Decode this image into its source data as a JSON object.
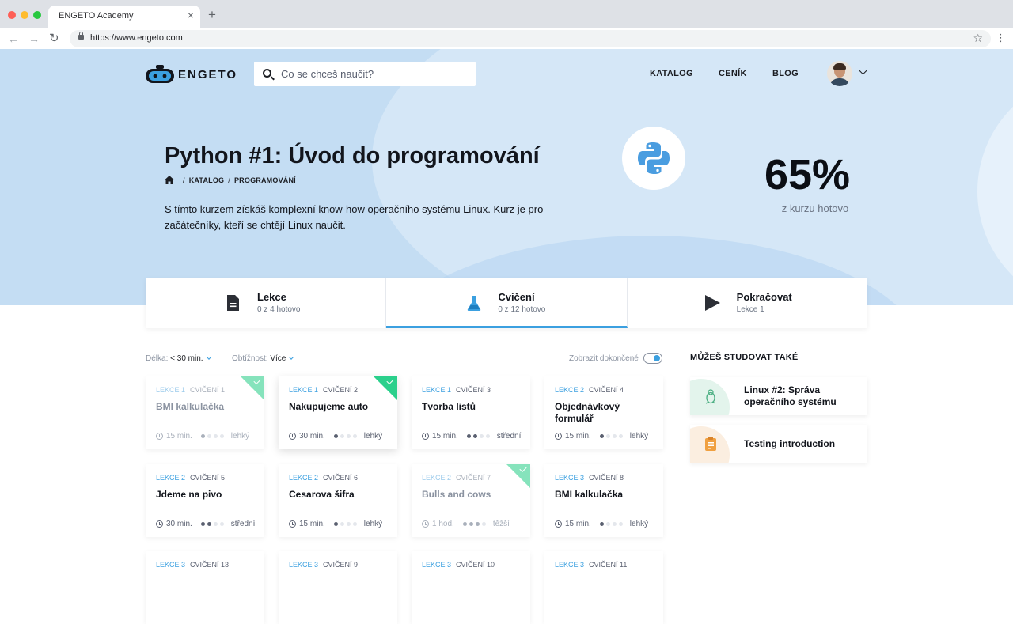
{
  "browser": {
    "tab_title": "ENGETO Academy",
    "tab_close": "×",
    "new_tab": "+",
    "url": "https://www.engeto.com",
    "back": "←",
    "forward": "→",
    "reload": "↻",
    "bookmark": "☆",
    "menu": "⋮"
  },
  "header": {
    "logo_text": "ENGETO",
    "search_placeholder": "Co se chceš naučit?",
    "nav": [
      "KATALOG",
      "CENÍK",
      "BLOG"
    ]
  },
  "hero": {
    "title": "Python #1: Úvod do programování",
    "breadcrumb": [
      "KATALOG",
      "PROGRAMOVÁNÍ"
    ],
    "breadcrumb_sep": "/",
    "description": "S tímto kurzem získáš komplexní know-how operačního systému Linux. Kurz je pro začátečníky, kteří se chtějí Linux naučit.",
    "progress_value": "65%",
    "progress_label": "z kurzu hotovo",
    "course_icon": "python-logo-icon"
  },
  "tabs": [
    {
      "title": "Lekce",
      "sub": "0 z 4 hotovo",
      "icon": "document-icon",
      "active": false
    },
    {
      "title": "Cvičení",
      "sub": "0 z 12 hotovo",
      "icon": "flask-icon",
      "active": true
    },
    {
      "title": "Pokračovat",
      "sub": "Lekce 1",
      "icon": "play-icon",
      "active": false
    }
  ],
  "filters": {
    "length_label": "Délka:",
    "length_value": "< 30 min.",
    "difficulty_label": "Obtížnost:",
    "difficulty_value": "Více",
    "show_completed_label": "Zobrazit dokončené",
    "show_completed": true
  },
  "exercises": [
    {
      "lesson": "LEKCE 1",
      "ex": "CVIČENÍ 1",
      "title": "BMI kalkulačka",
      "time": "15 min.",
      "level": 1,
      "diff": "lehký",
      "done": true
    },
    {
      "lesson": "LEKCE 1",
      "ex": "CVIČENÍ 2",
      "title": "Nakupujeme auto",
      "time": "30 min.",
      "level": 1,
      "diff": "lehký",
      "done": false,
      "checked": true
    },
    {
      "lesson": "LEKCE 1",
      "ex": "CVIČENÍ 3",
      "title": "Tvorba listů",
      "time": "15 min.",
      "level": 2,
      "diff": "střední",
      "done": false
    },
    {
      "lesson": "LEKCE 2",
      "ex": "CVIČENÍ 4",
      "title": "Objednávkový formulář",
      "time": "15 min.",
      "level": 1,
      "diff": "lehký",
      "done": false
    },
    {
      "lesson": "LEKCE 2",
      "ex": "CVIČENÍ 5",
      "title": "Jdeme na pivo",
      "time": "30 min.",
      "level": 2,
      "diff": "střední",
      "done": false
    },
    {
      "lesson": "LEKCE 2",
      "ex": "CVIČENÍ 6",
      "title": "Cesarova šifra",
      "time": "15 min.",
      "level": 1,
      "diff": "lehký",
      "done": false
    },
    {
      "lesson": "LEKCE 2",
      "ex": "CVIČENÍ 7",
      "title": "Bulls and cows",
      "time": "1 hod.",
      "level": 3,
      "diff": "těžší",
      "done": true
    },
    {
      "lesson": "LEKCE 3",
      "ex": "CVIČENÍ 8",
      "title": "BMI kalkulačka",
      "time": "15 min.",
      "level": 1,
      "diff": "lehký",
      "done": false
    },
    {
      "lesson": "LEKCE 3",
      "ex": "CVIČENÍ 13"
    },
    {
      "lesson": "LEKCE 3",
      "ex": "CVIČENÍ 9"
    },
    {
      "lesson": "LEKCE 3",
      "ex": "CVIČENÍ 10"
    },
    {
      "lesson": "LEKCE 3",
      "ex": "CVIČENÍ 11"
    }
  ],
  "sidebar": {
    "title": "MŮŽEŠ STUDOVAT TAKÉ",
    "courses": [
      {
        "title": "Linux #2: Správa operačního systému",
        "icon": "linux-penguin-icon",
        "color": "#e3f4ec"
      },
      {
        "title": "Testing introduction",
        "icon": "clipboard-icon",
        "color": "#fbeee0"
      }
    ]
  },
  "colors": {
    "accent": "#3ba0e0",
    "done_green": "#2bd08c",
    "hero_bg": "#c4ddf3"
  }
}
